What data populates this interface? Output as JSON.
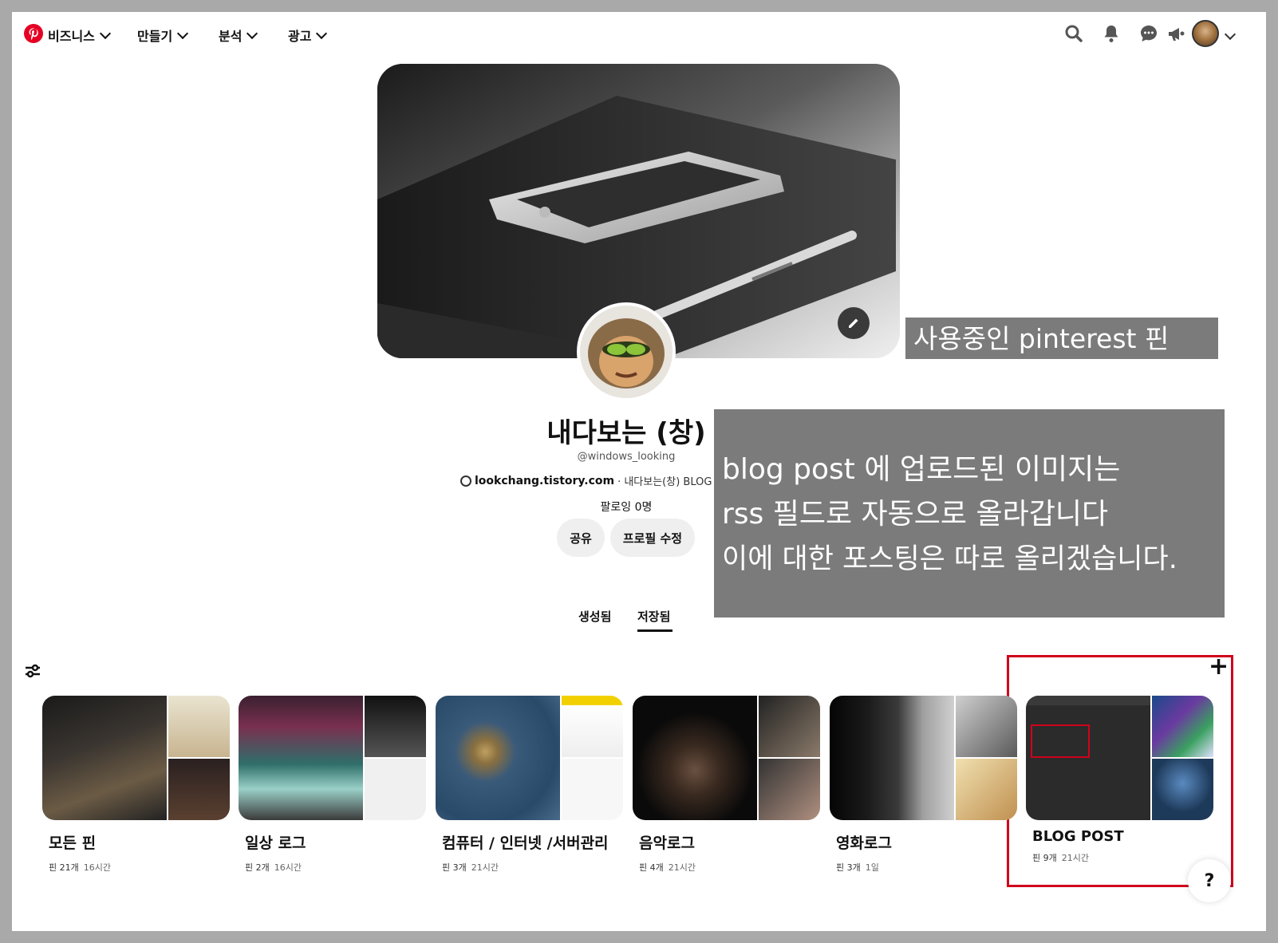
{
  "nav": {
    "logo": "pinterest-logo",
    "menus": [
      {
        "label": "비즈니스"
      },
      {
        "label": "만들기"
      },
      {
        "label": "분석"
      },
      {
        "label": "광고"
      }
    ],
    "icons": [
      "search-icon",
      "bell-icon",
      "chat-icon",
      "megaphone-icon",
      "avatar",
      "chevron-down-icon"
    ]
  },
  "profile": {
    "name": "내다보는 (창)",
    "handle": "@windows_looking",
    "website": "lookchang.tistory.com",
    "description": "· 내다보는(창) BLOG 운영중 입니다",
    "following": "팔로잉 0명",
    "buttons": {
      "share": "공유",
      "edit": "프로필 수정"
    },
    "tabs": {
      "created": "생성됨",
      "saved": "저장됨"
    }
  },
  "annotations": {
    "label1": "사용중인 pinterest 핀",
    "note_lines": [
      "blog post 에 업로드된 이미지는",
      "rss 필드로 자동으로 올라갑니다",
      "이에 대한 포스팅은 따로 올리겠습니다."
    ]
  },
  "boards": [
    {
      "title": "모든 핀",
      "pins": "핀 21개",
      "time": "16시간"
    },
    {
      "title": "일상 로그",
      "pins": "핀 2개",
      "time": "16시간"
    },
    {
      "title": "컴퓨터 / 인터넷 /서버관리",
      "pins": "핀 3개",
      "time": "21시간"
    },
    {
      "title": "음악로그",
      "pins": "핀 4개",
      "time": "21시간"
    },
    {
      "title": "영화로그",
      "pins": "핀 3개",
      "time": "1일"
    },
    {
      "title": "BLOG POST",
      "pins": "핀 9개",
      "time": "21시간"
    }
  ],
  "misc": {
    "help": "?",
    "add": "+"
  },
  "colors": {
    "brand": "#e60023",
    "highlight": "#d0021b",
    "annotation_bg": "#7b7b7b"
  }
}
